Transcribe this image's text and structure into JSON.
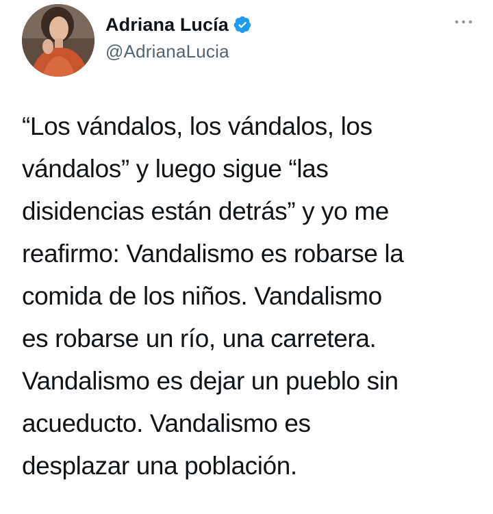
{
  "tweet": {
    "author": {
      "display_name": "Adriana Lucía",
      "handle": "@AdrianaLucia",
      "verified": true,
      "avatar_icon": "profile-photo",
      "verified_icon": "verified-badge-icon",
      "verified_color": "#1d9bf0"
    },
    "more_icon": "more-options-icon",
    "text_lines": [
      "“Los vándalos, los vándalos, los",
      "vándalos” y luego sigue “las",
      "disidencias están detrás” y yo me",
      "reafirmo: Vandalismo es robarse la",
      "comida de los niños. Vandalismo",
      "es robarse un río, una carretera.",
      "Vandalismo es dejar un pueblo sin",
      "acueducto. Vandalismo es",
      "desplazar una población."
    ]
  }
}
